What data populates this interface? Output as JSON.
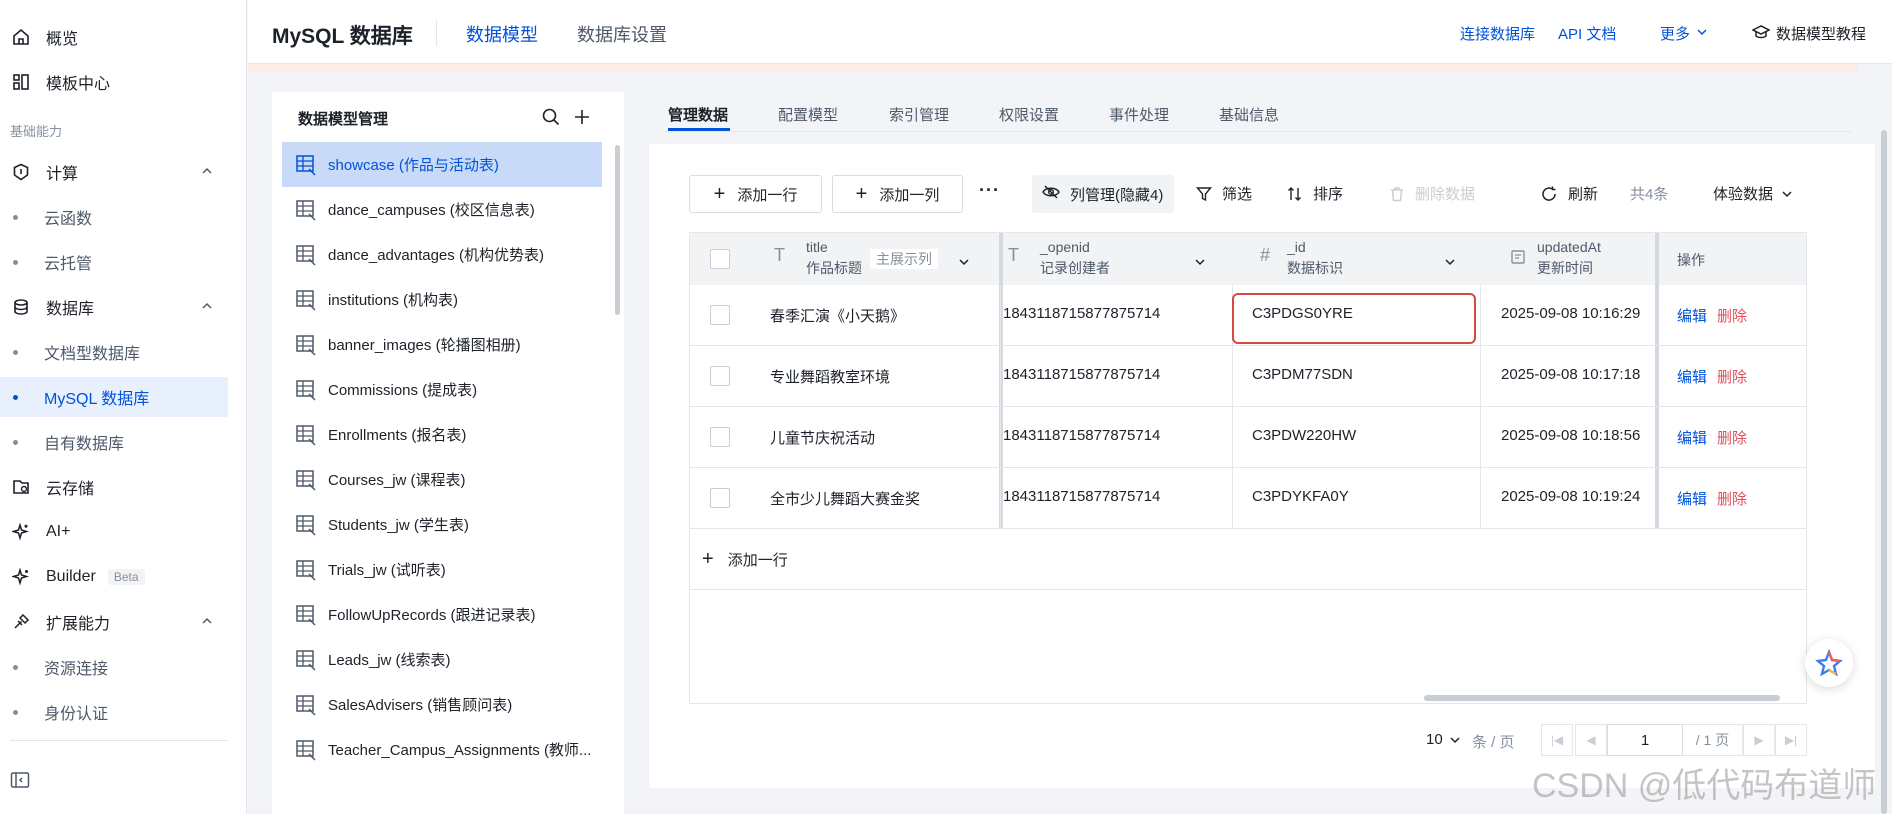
{
  "nav": {
    "overview": "概览",
    "template_center": "模板中心",
    "group_basic": "基础能力",
    "compute": "计算",
    "cloud_function": "云函数",
    "cloud_hosting": "云托管",
    "database": "数据库",
    "doc_db": "文档型数据库",
    "mysql_db": "MySQL 数据库",
    "own_db": "自有数据库",
    "cloud_storage": "云存储",
    "ai_plus": "AI+",
    "builder": "Builder",
    "builder_badge": "Beta",
    "ext": "扩展能力",
    "resource_connect": "资源连接",
    "auth": "身份认证"
  },
  "header": {
    "title": "MySQL 数据库",
    "tab_model": "数据模型",
    "tab_settings": "数据库设置",
    "link_connect": "连接数据库",
    "link_api": "API 文档",
    "link_more": "更多",
    "link_tutorial": "数据模型教程"
  },
  "model_panel": {
    "title": "数据模型管理",
    "items": [
      "showcase (作品与活动表)",
      "dance_campuses (校区信息表)",
      "dance_advantages (机构优势表)",
      "institutions (机构表)",
      "banner_images (轮播图相册)",
      "Commissions (提成表)",
      "Enrollments (报名表)",
      "Courses_jw (课程表)",
      "Students_jw (学生表)",
      "Trials_jw (试听表)",
      "FollowUpRecords (跟进记录表)",
      "Leads_jw (线索表)",
      "SalesAdvisers (销售顾问表)",
      "Teacher_Campus_Assignments (教师..."
    ]
  },
  "tabs": [
    "管理数据",
    "配置模型",
    "索引管理",
    "权限设置",
    "事件处理",
    "基础信息"
  ],
  "toolbar": {
    "add_row": "添加一行",
    "add_col": "添加一列",
    "more": "···",
    "col_mgr": "列管理(隐藏4)",
    "filter": "筛选",
    "sort": "排序",
    "delete": "删除数据",
    "refresh": "刷新",
    "count": "共4条",
    "env": "体验数据"
  },
  "table": {
    "columns": [
      {
        "name": "title",
        "sub": "作品标题",
        "type_icon": "T",
        "tag": "主展示列"
      },
      {
        "name": "_openid",
        "sub": "记录创建者",
        "type_icon": "T"
      },
      {
        "name": "_id",
        "sub": "数据标识",
        "type_icon": "#"
      },
      {
        "name": "updatedAt",
        "sub": "更新时间",
        "type_icon": "calendar"
      },
      {
        "name": "操作"
      }
    ],
    "rows": [
      {
        "title": "春季汇演《小天鹅》",
        "openid": "1843118715877875714",
        "id": "C3PDGS0YRE",
        "updated": "2025-09-08 10:16:29"
      },
      {
        "title": "专业舞蹈教室环境",
        "openid": "1843118715877875714",
        "id": "C3PDM77SDN",
        "updated": "2025-09-08 10:17:18"
      },
      {
        "title": "儿童节庆祝活动",
        "openid": "1843118715877875714",
        "id": "C3PDW220HW",
        "updated": "2025-09-08 10:18:56"
      },
      {
        "title": "全市少儿舞蹈大赛金奖",
        "openid": "1843118715877875714",
        "id": "C3PDYKFA0Y",
        "updated": "2025-09-08 10:19:24"
      }
    ],
    "action_edit": "编辑",
    "action_delete": "删除",
    "add_row": "添加一行"
  },
  "pagination": {
    "page_size": "10",
    "unit": "条 / 页",
    "page": "1",
    "total": "/ 1 页"
  },
  "watermark": "CSDN @低代码布道师",
  "colors": {
    "primary": "#0052d9",
    "danger": "#e34d59",
    "highlight_border": "#d54941"
  }
}
